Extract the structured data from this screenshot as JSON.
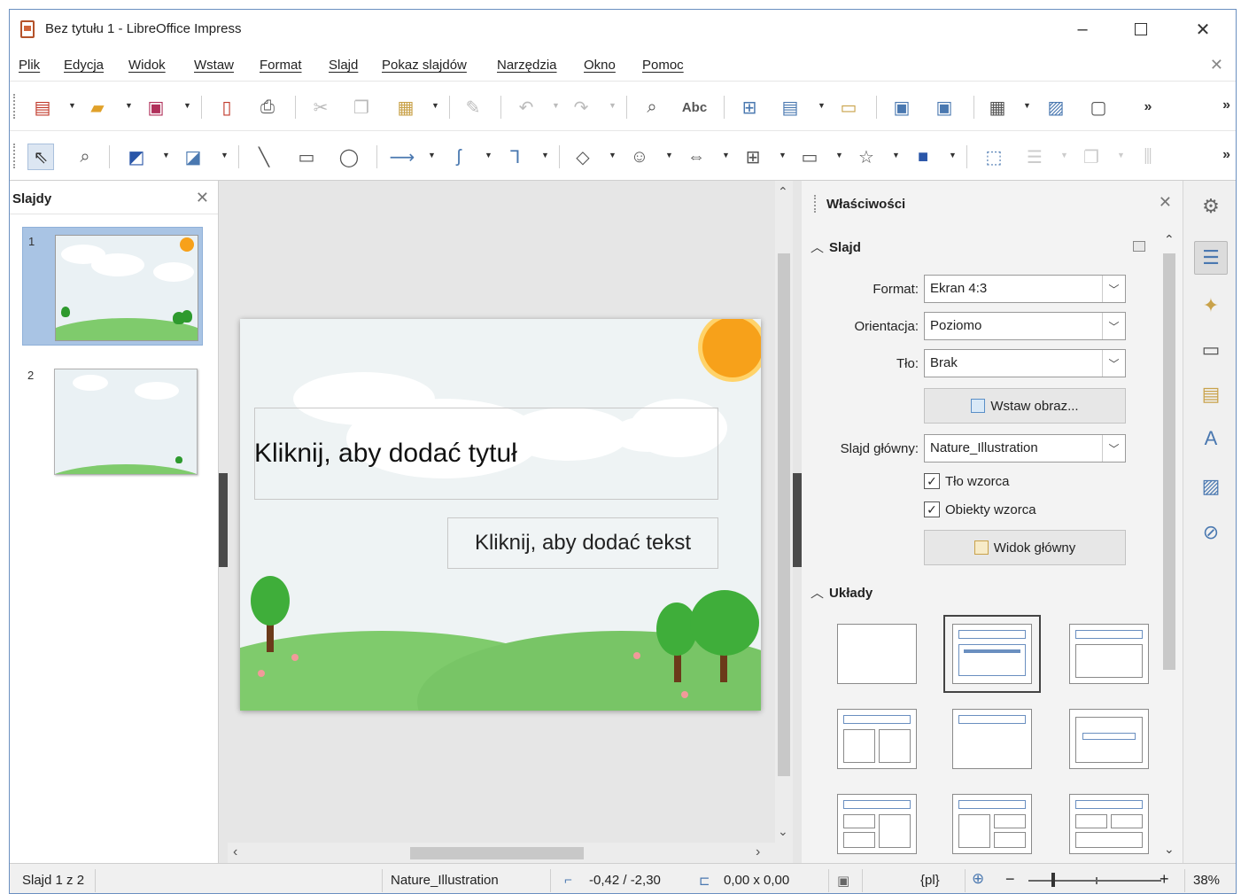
{
  "window": {
    "title": "Bez tytułu 1 - LibreOffice Impress",
    "minimize": "–",
    "close": "✕"
  },
  "menubar": {
    "items": [
      "Plik",
      "Edycja",
      "Widok",
      "Wstaw",
      "Format",
      "Slajd",
      "Pokaz slajdów",
      "Narzędzia",
      "Okno",
      "Pomoc"
    ],
    "close": "✕"
  },
  "toolbar_standard": {
    "icons": [
      "new-icon",
      "open-icon",
      "save-icon",
      "export-pdf-icon",
      "print-icon",
      "cut-icon",
      "copy-icon",
      "paste-icon",
      "clone-formatting-icon",
      "undo-icon",
      "redo-icon",
      "find-replace-icon",
      "spelling-icon",
      "grid-icon",
      "display-views-icon",
      "master-slide-icon",
      "start-from-first-icon",
      "start-from-current-icon",
      "table-icon",
      "image-icon",
      "frame-icon"
    ],
    "spelling_label": "Abc",
    "more": "»",
    "more2": "»"
  },
  "toolbar_drawing": {
    "icons": [
      "select-icon",
      "zoom-icon",
      "line-color-icon",
      "fill-color-icon",
      "line-icon",
      "rectangle-icon",
      "ellipse-icon",
      "arrow-line-icon",
      "curve-icon",
      "connector-icon",
      "basic-shapes-icon",
      "symbol-shapes-icon",
      "block-arrows-icon",
      "flowchart-icon",
      "callout-icon",
      "stars-icon",
      "3d-objects-icon",
      "transformations-icon",
      "align-icon",
      "arrange-icon",
      "distribute-icon"
    ],
    "more": "»"
  },
  "slides_pane": {
    "title": "Slajdy",
    "close": "✕",
    "slides": [
      {
        "number": "1"
      },
      {
        "number": "2"
      }
    ]
  },
  "slide": {
    "title_placeholder": "Kliknij, aby dodać tytuł",
    "text_placeholder": "Kliknij, aby dodać tekst"
  },
  "properties": {
    "title": "Właściwości",
    "close": "✕",
    "slide_section": {
      "heading": "Slajd",
      "format_label": "Format:",
      "format_value": "Ekran 4:3",
      "orientation_label": "Orientacja:",
      "orientation_value": "Poziomo",
      "background_label": "Tło:",
      "background_value": "Brak",
      "insert_image_button": "Wstaw obraz...",
      "master_slide_label": "Slajd główny:",
      "master_slide_value": "Nature_Illustration",
      "master_background_check": "Tło wzorca",
      "master_objects_check": "Obiekty wzorca",
      "master_view_button": "Widok główny"
    },
    "layouts_section": {
      "heading": "Układy"
    }
  },
  "statusbar": {
    "slide_info": "Slajd 1 z 2",
    "master_name": "Nature_Illustration",
    "position": "-0,42 / -2,30",
    "size": "0,00 x 0,00",
    "language": "{pl}",
    "zoom_minus": "−",
    "zoom_plus": "+",
    "zoom_level": "38%"
  },
  "colors": {
    "accent": "#4a78b0",
    "slide_selection": "#a9c4e4",
    "sun": "#f7a11a",
    "grass": "#7fcb6c"
  }
}
